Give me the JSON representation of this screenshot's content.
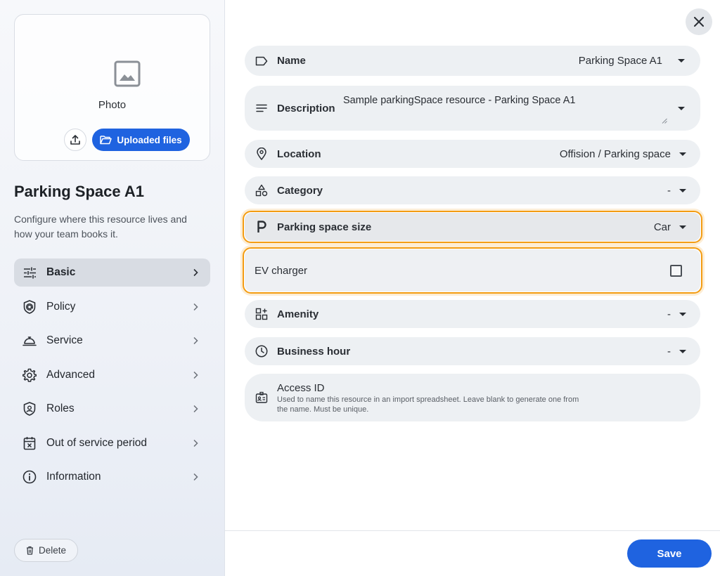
{
  "sidebar": {
    "photo_label": "Photo",
    "uploaded_files_label": "Uploaded files",
    "resource_title": "Parking Space A1",
    "resource_description": "Configure where this resource lives and how your team books it.",
    "nav": [
      {
        "label": "Basic",
        "icon": "sliders-icon",
        "active": true
      },
      {
        "label": "Policy",
        "icon": "shield-at-icon"
      },
      {
        "label": "Service",
        "icon": "room-service-icon"
      },
      {
        "label": "Advanced",
        "icon": "gear-icon"
      },
      {
        "label": "Roles",
        "icon": "shield-user-icon"
      },
      {
        "label": "Out of service period",
        "icon": "calendar-x-icon"
      },
      {
        "label": "Information",
        "icon": "info-icon"
      }
    ],
    "delete_label": "Delete"
  },
  "form": {
    "name": {
      "label": "Name",
      "value": "Parking Space A1"
    },
    "description": {
      "label": "Description",
      "value": "Sample parkingSpace resource - Parking Space A1"
    },
    "location": {
      "label": "Location",
      "value": "Offision / Parking space"
    },
    "category": {
      "label": "Category",
      "value": "-"
    },
    "parking_size": {
      "label": "Parking space size",
      "value": "Car"
    },
    "ev_charger": {
      "label": "EV charger",
      "checked": false
    },
    "amenity": {
      "label": "Amenity",
      "value": "-"
    },
    "business_hour": {
      "label": "Business hour",
      "value": "-"
    },
    "access_id": {
      "label": "Access ID",
      "help": "Used to name this resource in an import spreadsheet. Leave blank to generate one from the name. Must be unique."
    }
  },
  "footer": {
    "save_label": "Save"
  },
  "colors": {
    "accent": "#1f63e0",
    "highlight": "#f39c12"
  }
}
